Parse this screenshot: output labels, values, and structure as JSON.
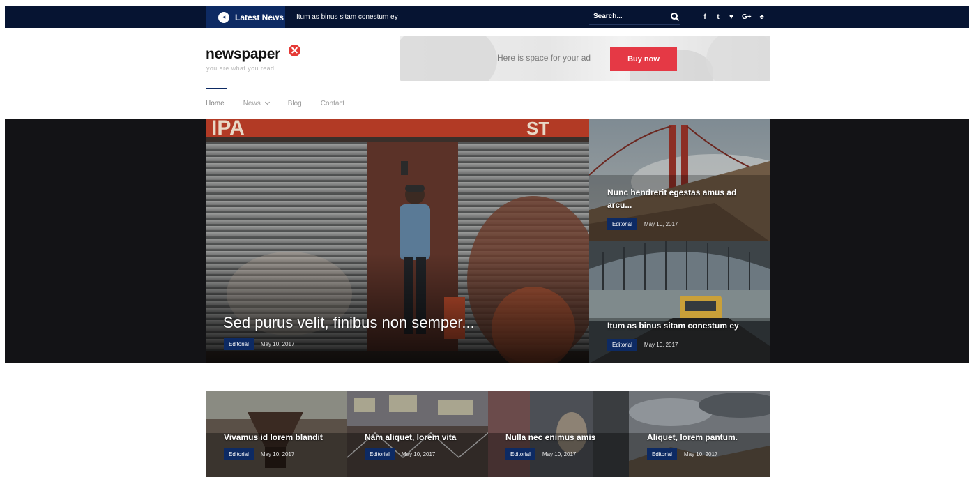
{
  "topbar": {
    "latest_label": "Latest News",
    "ticker": "Itum as binus sitam conestum ey",
    "search_placeholder": "Search...",
    "social": [
      "f",
      "t",
      "♥",
      "G+",
      "♣"
    ]
  },
  "header": {
    "logo": "newspaper",
    "tagline": "you are what you read",
    "ad_text": "Here is space for your ad",
    "buy_label": "Buy now"
  },
  "nav": {
    "home": "Home",
    "news": "News",
    "blog": "Blog",
    "contact": "Contact"
  },
  "hero": {
    "main": {
      "title": "Sed purus velit, finibus non semper...",
      "category": "Editorial",
      "date": "May 10, 2017"
    },
    "side1": {
      "title": "Nunc hendrerit egestas amus ad arcu...",
      "category": "Editorial",
      "date": "May 10, 2017"
    },
    "side2": {
      "title": "Itum as binus sitam conestum ey",
      "category": "Editorial",
      "date": "May 10, 2017"
    }
  },
  "grid": [
    {
      "title": "Vivamus id lorem blandit",
      "category": "Editorial",
      "date": "May 10, 2017"
    },
    {
      "title": "Nam aliquet, lorem vita",
      "category": "Editorial",
      "date": "May 10, 2017"
    },
    {
      "title": "Nulla nec enimus amis",
      "category": "Editorial",
      "date": "May 10, 2017"
    },
    {
      "title": "Aliquet, lorem pantum.",
      "category": "Editorial",
      "date": "May 10, 2017"
    }
  ],
  "colors": {
    "navy": "#061432",
    "accent_blue": "#0d2a63",
    "buy_red": "#e53945",
    "logo_red": "#e53935"
  }
}
